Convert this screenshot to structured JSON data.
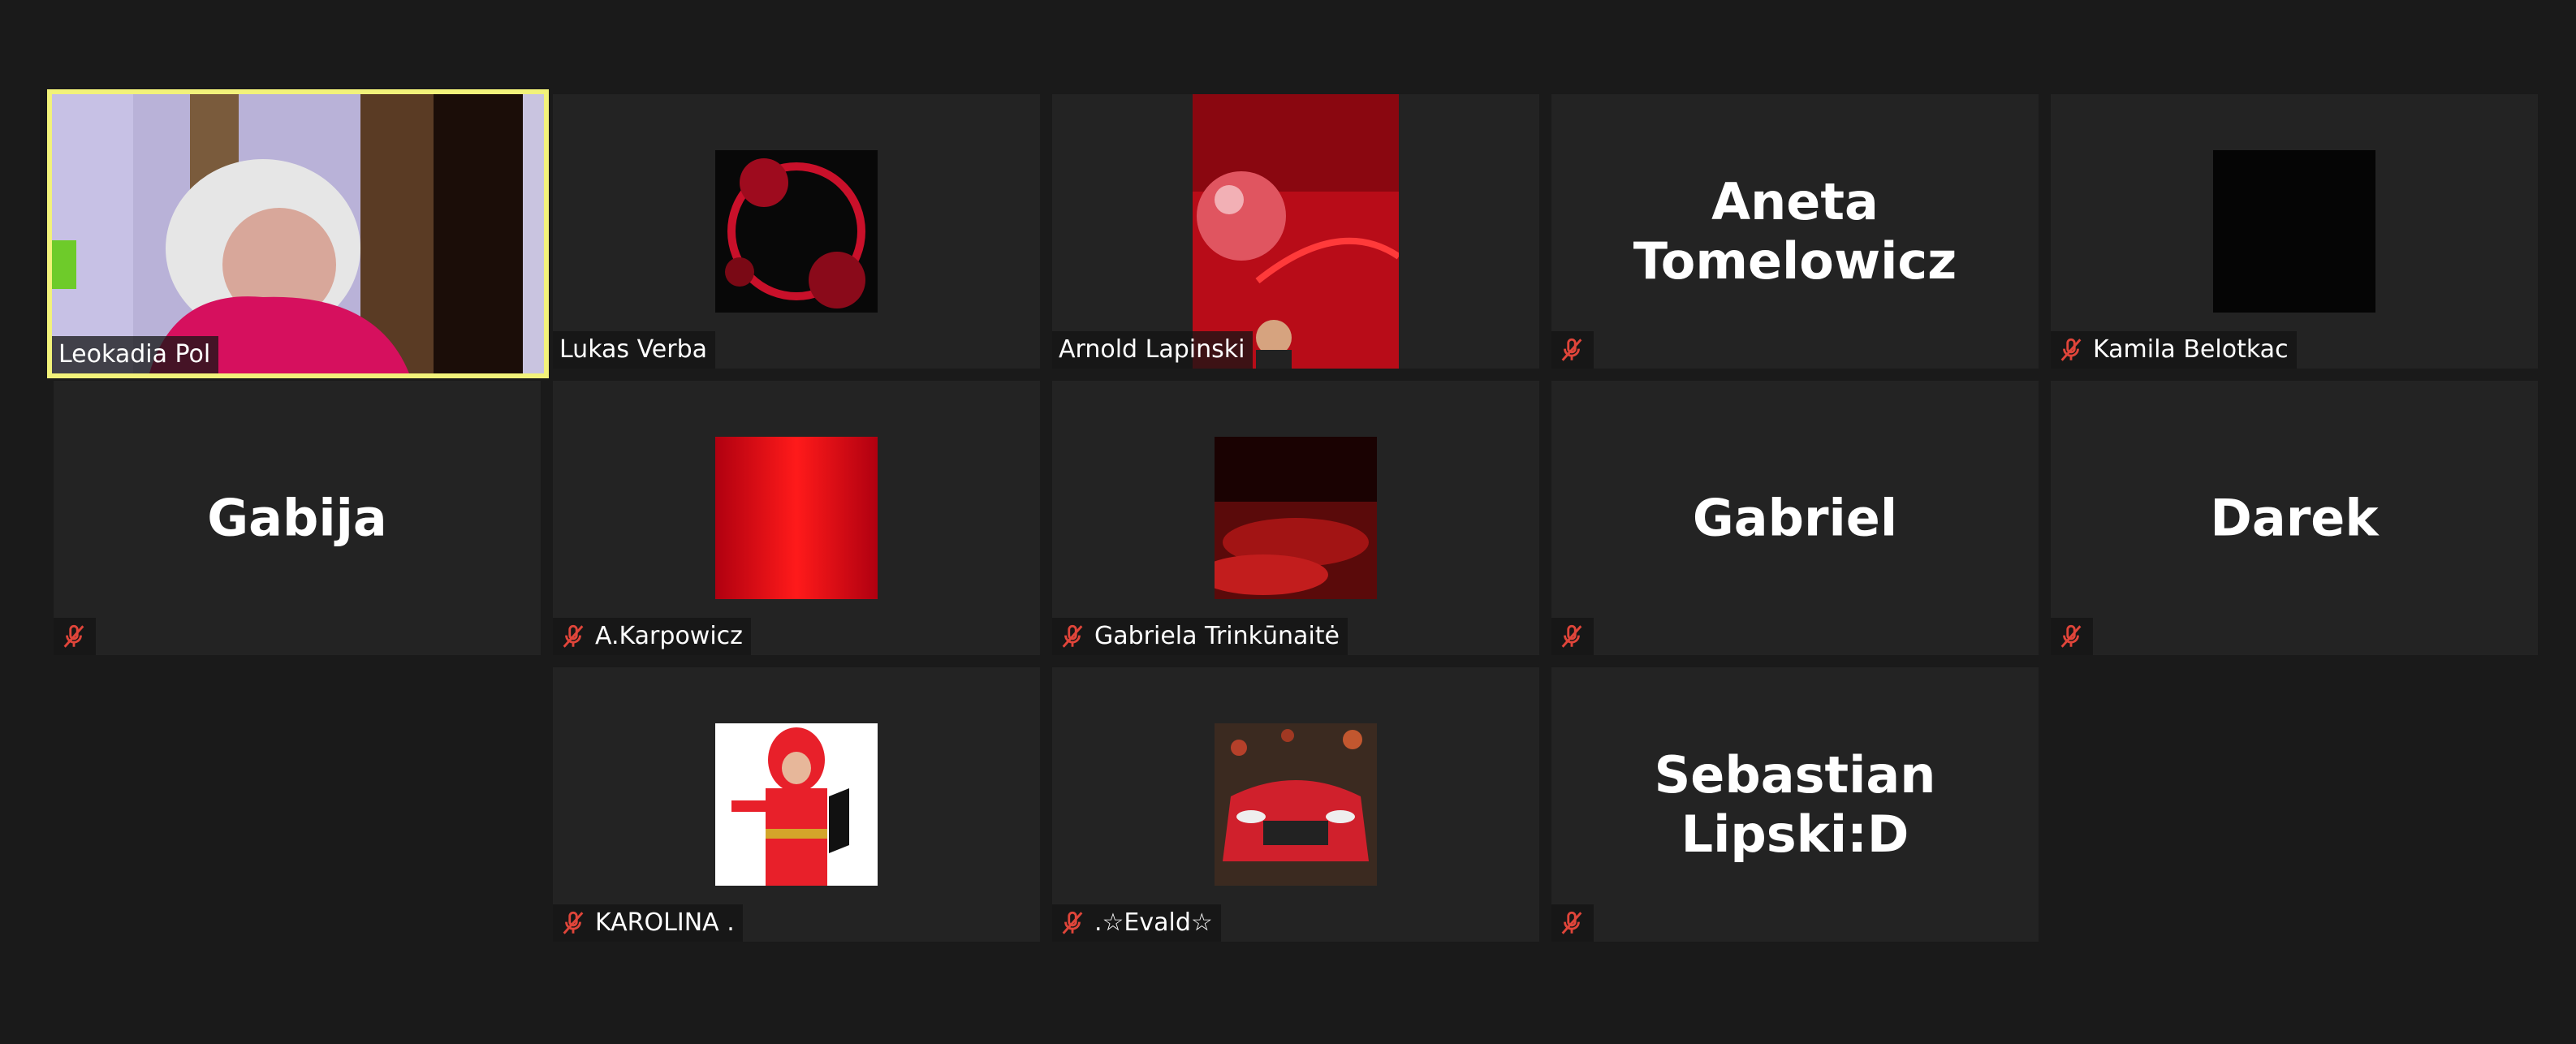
{
  "participants": [
    {
      "name": "Leokadia Pol",
      "video": "camera",
      "muted": false,
      "active": true
    },
    {
      "name": "Lukas Verba",
      "video": "avatar-red-eclipse",
      "muted": false
    },
    {
      "name": "Arnold Lapinski",
      "video": "avatar-red-bubble-portrait",
      "muted": false
    },
    {
      "name": "Aneta Tomelowicz",
      "video": "name-only",
      "muted": true
    },
    {
      "name": "Kamila Belotkac",
      "video": "avatar-black",
      "muted": true
    },
    {
      "name": "Gabija",
      "video": "name-only",
      "muted": true
    },
    {
      "name": "A.Karpowicz",
      "video": "avatar-red-gradient",
      "muted": true
    },
    {
      "name": "Gabriela Trinkūnaitė",
      "video": "avatar-dark-red-landscape",
      "muted": true
    },
    {
      "name": "Gabriel",
      "video": "name-only",
      "muted": true
    },
    {
      "name": "Darek",
      "video": "name-only",
      "muted": true
    },
    {
      "name": "KAROLINA .",
      "video": "avatar-red-costume",
      "muted": true
    },
    {
      "name": ".☆Evald☆",
      "video": "avatar-red-car",
      "muted": true
    },
    {
      "name": "Sebastian Lipski:D",
      "video": "name-only",
      "muted": true
    }
  ],
  "icons": {
    "mute": "microphone-muted-icon"
  },
  "colors": {
    "active_border": "#f2f27a",
    "mute_red": "#e0453a",
    "tile_bg": "#232323",
    "page_bg": "#1a1a1a"
  }
}
